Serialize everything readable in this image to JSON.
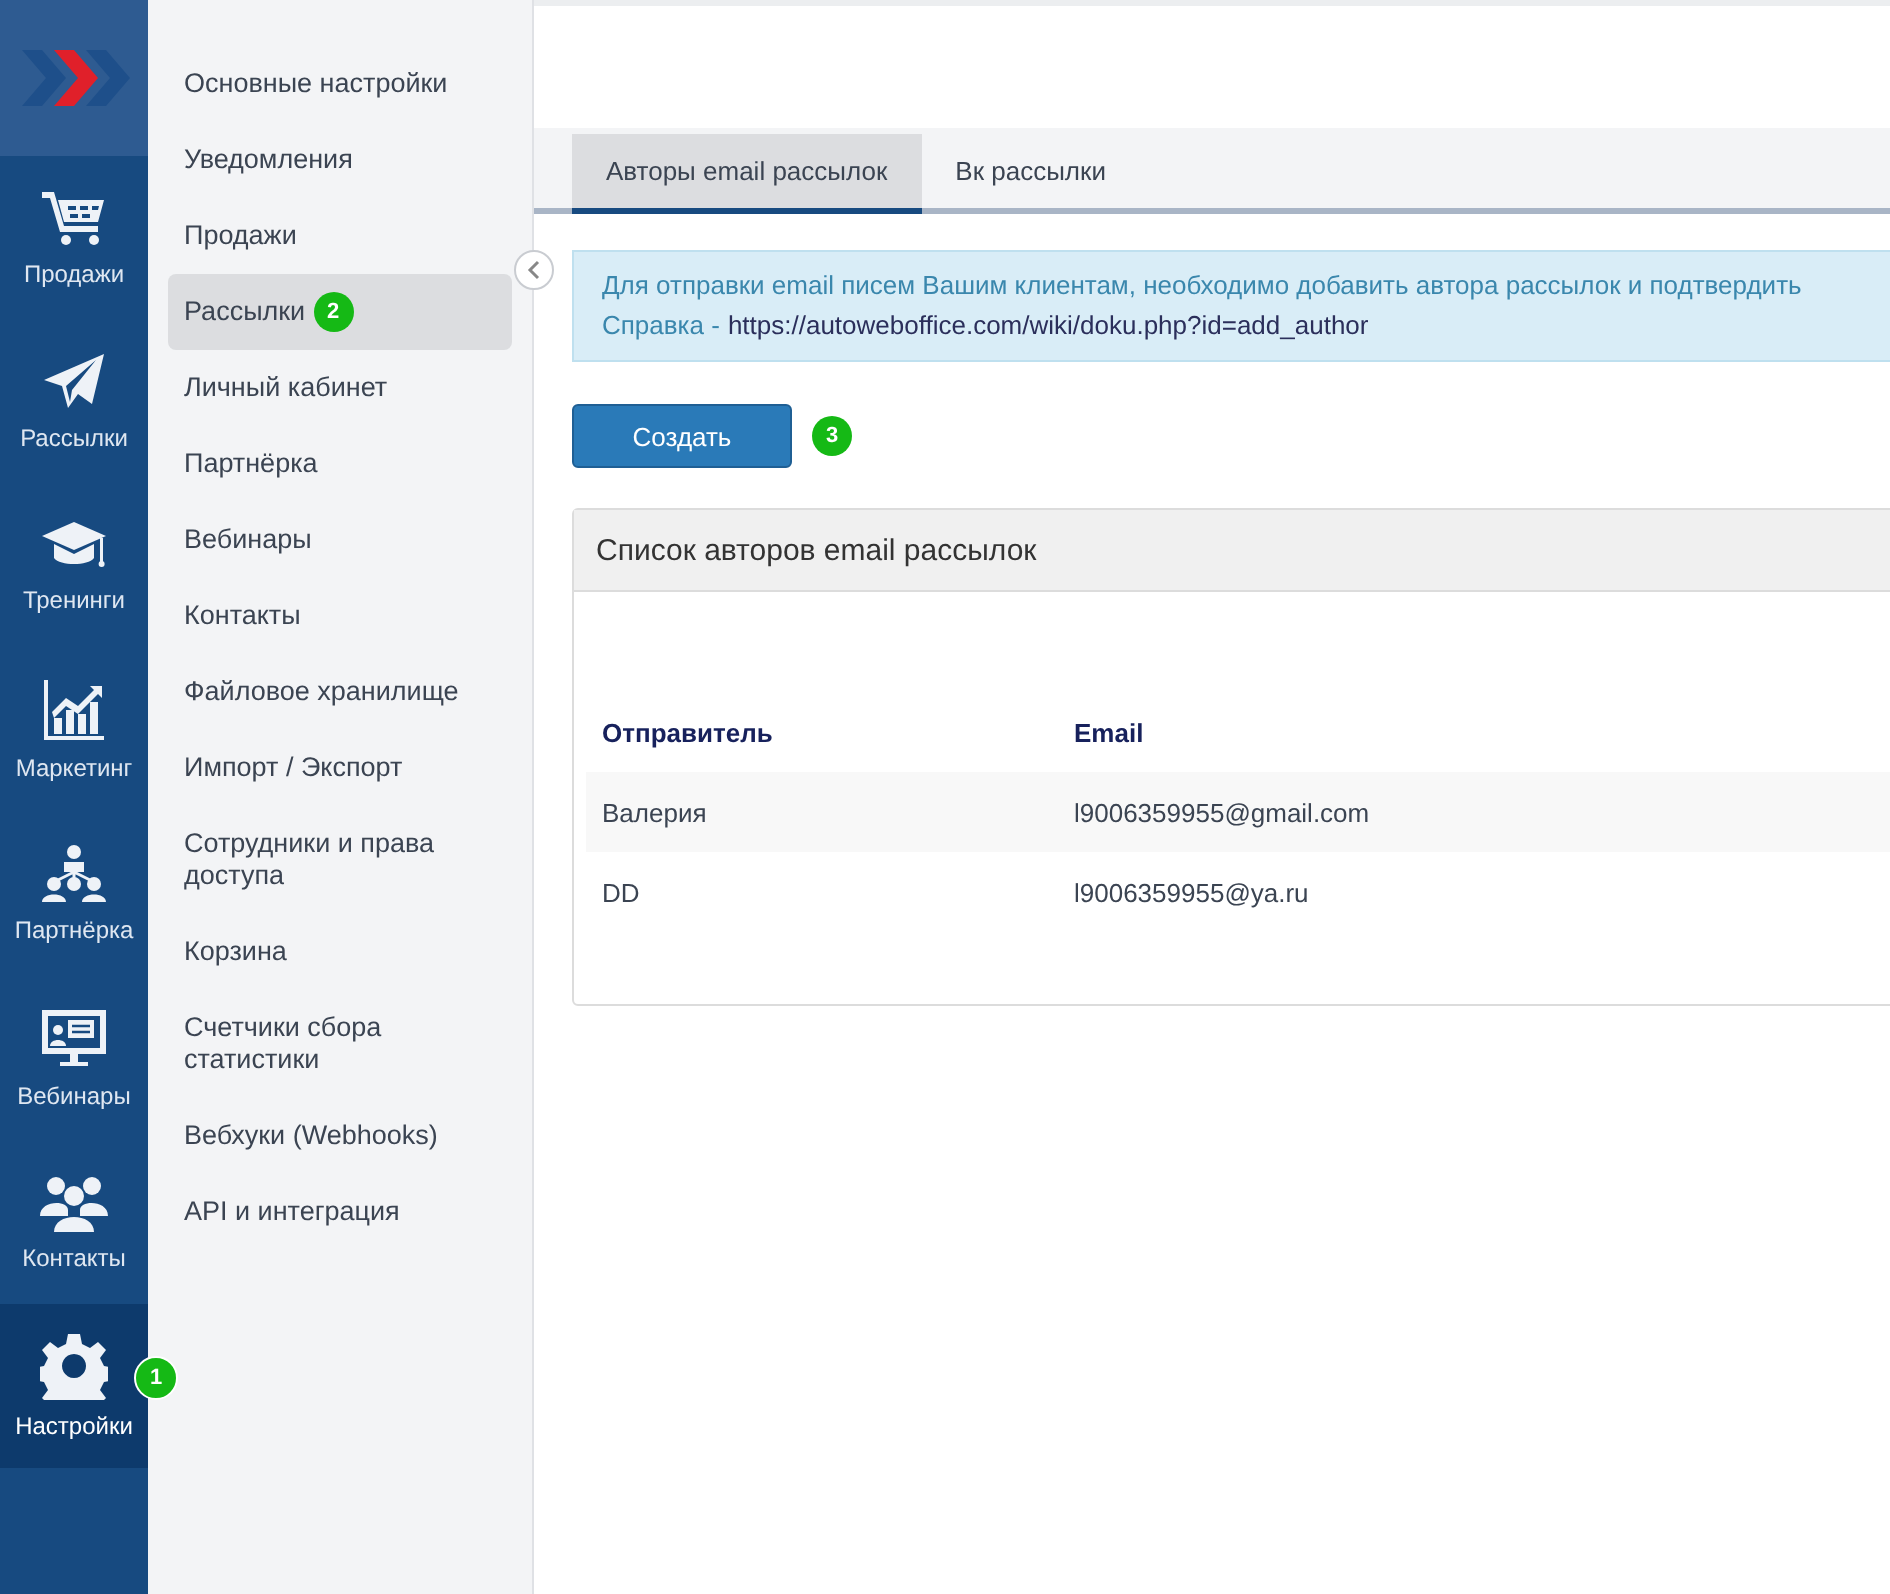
{
  "nav": [
    {
      "label": "Продажи",
      "kind": "cart",
      "selected": false
    },
    {
      "label": "Рассылки",
      "kind": "plane",
      "selected": false
    },
    {
      "label": "Тренинги",
      "kind": "cap",
      "selected": false
    },
    {
      "label": "Маркетинг",
      "kind": "chart",
      "selected": false
    },
    {
      "label": "Партнёрка",
      "kind": "tree",
      "selected": false
    },
    {
      "label": "Вебинары",
      "kind": "monitor",
      "selected": false
    },
    {
      "label": "Контакты",
      "kind": "group",
      "selected": false
    },
    {
      "label": "Настройки",
      "kind": "gear",
      "selected": true,
      "badge": "1"
    }
  ],
  "submenu": [
    {
      "label": "Основные настройки",
      "selected": false
    },
    {
      "label": "Уведомления",
      "selected": false
    },
    {
      "label": "Продажи",
      "selected": false
    },
    {
      "label": "Рассылки",
      "selected": true,
      "badge": "2"
    },
    {
      "label": "Личный кабинет",
      "selected": false
    },
    {
      "label": "Партнёрка",
      "selected": false
    },
    {
      "label": "Вебинары",
      "selected": false
    },
    {
      "label": "Контакты",
      "selected": false
    },
    {
      "label": "Файловое хранилище",
      "selected": false
    },
    {
      "label": "Импорт / Экспорт",
      "selected": false
    },
    {
      "label": "Сотрудники и права доступа",
      "selected": false
    },
    {
      "label": "Корзина",
      "selected": false
    },
    {
      "label": "Счетчики сбора статистики",
      "selected": false
    },
    {
      "label": "Вебхуки (Webhooks)",
      "selected": false
    },
    {
      "label": "API и интеграция",
      "selected": false
    }
  ],
  "tabs": [
    {
      "label": "Авторы email рассылок",
      "selected": true
    },
    {
      "label": "Вк рассылки",
      "selected": false
    }
  ],
  "alert": {
    "text": "Для отправки email писем Вашим клиентам, необходимо добавить автора рассылок и подтвердить",
    "help_label": "Справка -",
    "help_link": "https://autoweboffice.com/wiki/doku.php?id=add_author"
  },
  "create_button": {
    "label": "Создать",
    "badge": "3"
  },
  "panel": {
    "title": "Список авторов email рассылок",
    "columns": [
      "Отправитель",
      "Email"
    ],
    "rows": [
      [
        "Валерия",
        "l9006359955@gmail.com"
      ],
      [
        "DD",
        "l9006359955@ya.ru"
      ]
    ]
  }
}
